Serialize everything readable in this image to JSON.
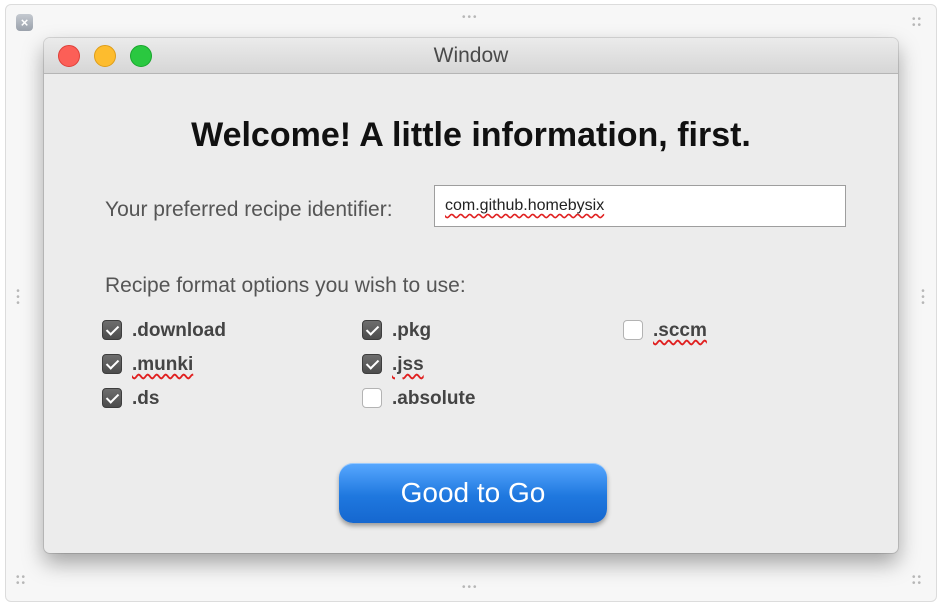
{
  "window": {
    "title": "Window"
  },
  "content": {
    "headline": "Welcome! A little information, first.",
    "identifier_label": "Your preferred recipe identifier:",
    "identifier_value": "com.github.homebysix",
    "formats_label": "Recipe format options you wish to use:",
    "formats": [
      {
        "label": ".download",
        "checked": true
      },
      {
        "label": ".munki",
        "checked": true
      },
      {
        "label": ".ds",
        "checked": true
      },
      {
        "label": ".pkg",
        "checked": true
      },
      {
        "label": ".jss",
        "checked": true
      },
      {
        "label": ".absolute",
        "checked": false
      },
      {
        "label": ".sccm",
        "checked": false
      }
    ],
    "submit_label": "Good to Go"
  },
  "icons": {
    "frame_close": "close-icon",
    "checkbox_checked": "checkmark-icon"
  },
  "colors": {
    "button_blue": "#1f78df",
    "close_red": "#fc5f57",
    "minimize_yellow": "#fdbc2e",
    "zoom_green": "#2ac840"
  }
}
